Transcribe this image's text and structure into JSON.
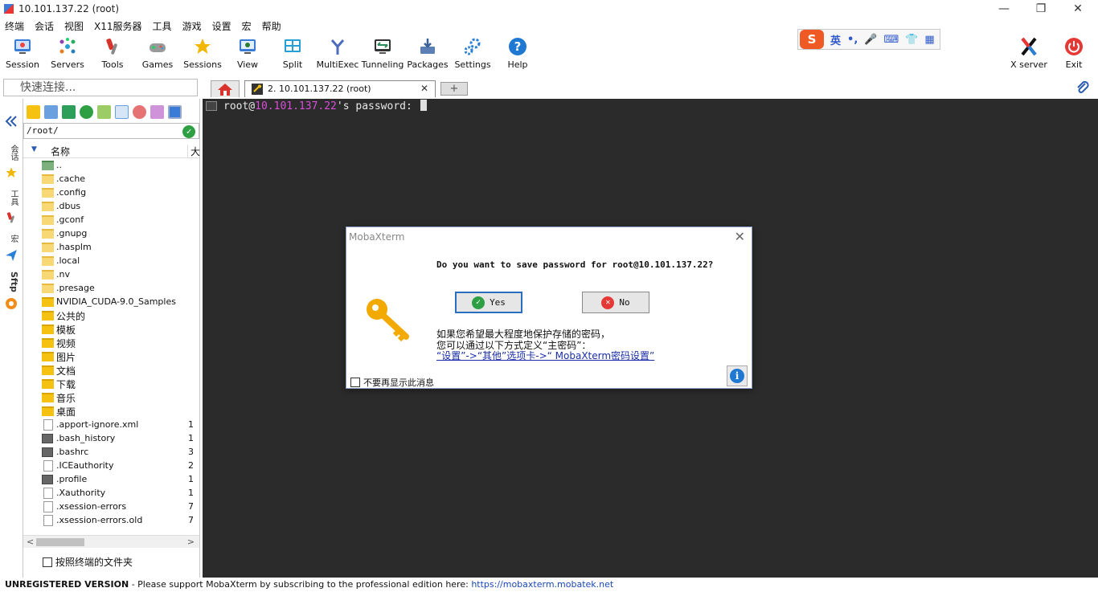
{
  "window": {
    "title": "10.101.137.22 (root)",
    "minimize": "—",
    "restore": "❐",
    "close": "✕"
  },
  "menu": [
    "终端",
    "会话",
    "视图",
    "X11服务器",
    "工具",
    "游戏",
    "设置",
    "宏",
    "帮助"
  ],
  "toolbar": {
    "buttons": [
      {
        "label": "Session",
        "icon": "session-icon",
        "color": "#3a7bd5"
      },
      {
        "label": "Servers",
        "icon": "servers-icon",
        "color": "#2a9fd6"
      },
      {
        "label": "Tools",
        "icon": "tools-icon",
        "color": "#d9342b"
      },
      {
        "label": "Games",
        "icon": "games-icon",
        "color": "#777777"
      },
      {
        "label": "Sessions",
        "icon": "star-icon",
        "color": "#f2b705"
      },
      {
        "label": "View",
        "icon": "view-icon",
        "color": "#3a7bd5"
      },
      {
        "label": "Split",
        "icon": "split-icon",
        "color": "#2a9fd6"
      },
      {
        "label": "MultiExec",
        "icon": "multiexec-icon",
        "color": "#4f6bbd"
      },
      {
        "label": "Tunneling",
        "icon": "tunneling-icon",
        "color": "#2e8b57"
      },
      {
        "label": "Packages",
        "icon": "packages-icon",
        "color": "#5b7fb5"
      },
      {
        "label": "Settings",
        "icon": "settings-icon",
        "color": "#2a7fd6"
      },
      {
        "label": "Help",
        "icon": "help-icon",
        "color": "#1f78d1"
      }
    ],
    "xserver_label": "X server",
    "exit_label": "Exit"
  },
  "ime": {
    "lang": "英",
    "punct": "•,",
    "mic": "🎤",
    "kbd": "⌨",
    "shirt": "👕",
    "grid": "▦"
  },
  "quick_connect": {
    "placeholder": "快速连接..."
  },
  "tabs": {
    "active_label": "2. 10.101.137.22 (root)",
    "close": "✕",
    "add": "+"
  },
  "vertical_tabs": {
    "sessions": "会话",
    "tools": "工具",
    "macros": "宏",
    "sftp": "Sftp"
  },
  "sftp": {
    "path": "/root/",
    "header_name": "名称",
    "header_size": "大",
    "files": [
      {
        "name": "..",
        "size": "",
        "type": "up"
      },
      {
        "name": ".cache",
        "size": "",
        "type": "folder"
      },
      {
        "name": ".config",
        "size": "",
        "type": "folder"
      },
      {
        "name": ".dbus",
        "size": "",
        "type": "folder"
      },
      {
        "name": ".gconf",
        "size": "",
        "type": "folder"
      },
      {
        "name": ".gnupg",
        "size": "",
        "type": "folder"
      },
      {
        "name": ".hasplm",
        "size": "",
        "type": "folder"
      },
      {
        "name": ".local",
        "size": "",
        "type": "folder"
      },
      {
        "name": ".nv",
        "size": "",
        "type": "folder"
      },
      {
        "name": ".presage",
        "size": "",
        "type": "folder"
      },
      {
        "name": "NVIDIA_CUDA-9.0_Samples",
        "size": "",
        "type": "folderb"
      },
      {
        "name": "公共的",
        "size": "",
        "type": "folderb"
      },
      {
        "name": "模板",
        "size": "",
        "type": "folderb"
      },
      {
        "name": "视频",
        "size": "",
        "type": "folderb"
      },
      {
        "name": "图片",
        "size": "",
        "type": "folderb"
      },
      {
        "name": "文档",
        "size": "",
        "type": "folderb"
      },
      {
        "name": "下载",
        "size": "",
        "type": "folderb"
      },
      {
        "name": "音乐",
        "size": "",
        "type": "folderb"
      },
      {
        "name": "桌面",
        "size": "",
        "type": "folderb"
      },
      {
        "name": ".apport-ignore.xml",
        "size": "1",
        "type": "file"
      },
      {
        "name": ".bash_history",
        "size": "1",
        "type": "term"
      },
      {
        "name": ".bashrc",
        "size": "3",
        "type": "term"
      },
      {
        "name": ".ICEauthority",
        "size": "2",
        "type": "file"
      },
      {
        "name": ".profile",
        "size": "1",
        "type": "term"
      },
      {
        "name": ".Xauthority",
        "size": "1",
        "type": "file"
      },
      {
        "name": ".xsession-errors",
        "size": "7",
        "type": "file"
      },
      {
        "name": ".xsession-errors.old",
        "size": "7",
        "type": "file"
      }
    ],
    "follow_terminal": "按照终端的文件夹"
  },
  "terminal": {
    "user": "root@",
    "host": "10.101.137.22",
    "suffix": "'s password: "
  },
  "dialog": {
    "title": "MobaXterm",
    "question": "Do you want to save password for root@10.101.137.22?",
    "yes": "Yes",
    "no": "No",
    "info_line1": "如果您希望最大程度地保护存储的密码，",
    "info_line2": "您可以通过以下方式定义“主密码”：",
    "info_link": "“设置”->“其他”选项卡->“ MobaXterm密码设置”",
    "dont_show": "不要再显示此消息"
  },
  "status": {
    "unregistered": "UNREGISTERED VERSION",
    "message": "  -  Please support MobaXterm by subscribing to the professional edition here:  ",
    "link": "https://mobaxterm.mobatek.net"
  }
}
